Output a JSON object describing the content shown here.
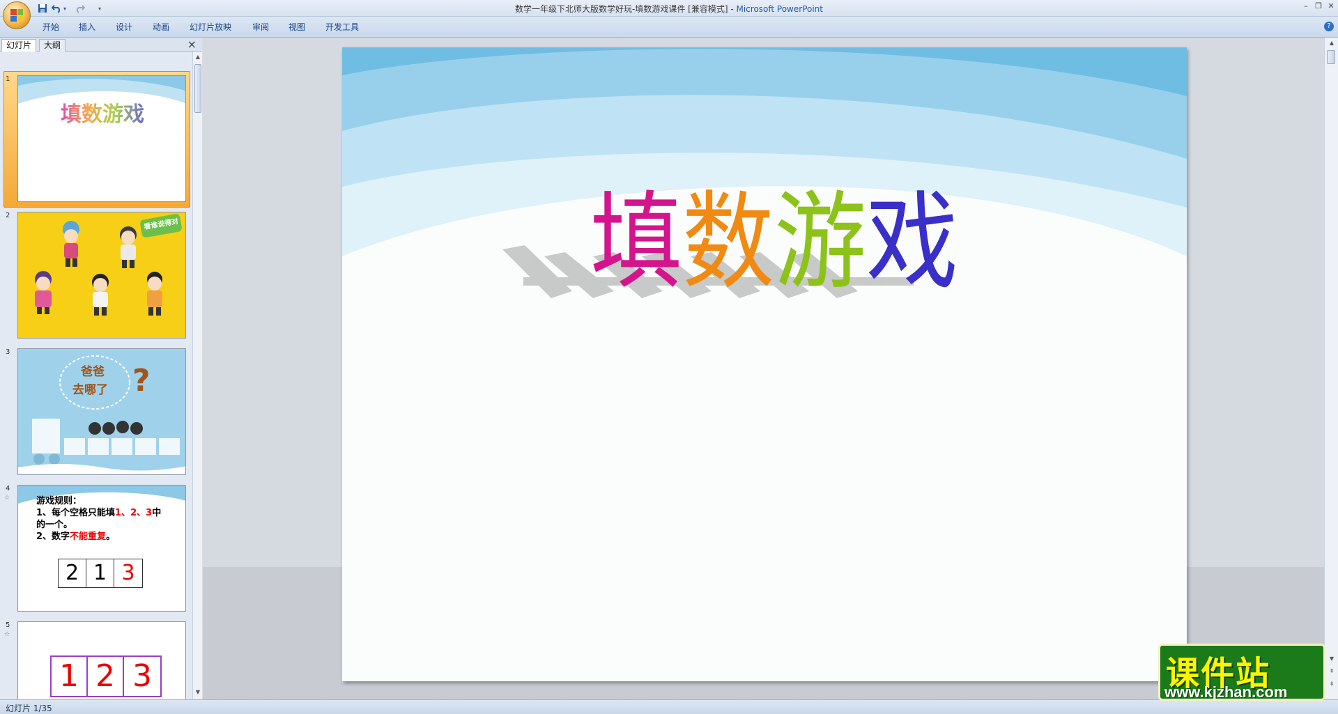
{
  "window": {
    "title_doc": "数学一年级下北师大版数学好玩-填数游戏课件 [兼容模式] - ",
    "title_app": "Microsoft PowerPoint"
  },
  "ribbon": {
    "tabs": [
      "开始",
      "插入",
      "设计",
      "动画",
      "幻灯片放映",
      "审阅",
      "视图",
      "开发工具"
    ]
  },
  "panel": {
    "tab_slides": "幻灯片",
    "tab_outline": "大纲",
    "close_glyph": "×"
  },
  "thumbnails": [
    {
      "num": "1",
      "title": "填数游戏"
    },
    {
      "num": "2",
      "badge": "看谁说得对"
    },
    {
      "num": "3",
      "bubble_line1": "爸爸",
      "bubble_line2": "去哪了",
      "question": "?"
    },
    {
      "num": "4",
      "rules_title": "游戏规则：",
      "rule1_a": "1、每个空格只能填",
      "rule1_b": "1、2、3",
      "rule1_c": "中",
      "rule1_d": "的一个。",
      "rule2_a": "2、数字",
      "rule2_b": "不能重复",
      "rule2_c": "。",
      "cells": [
        "2",
        "1",
        "3"
      ]
    },
    {
      "num": "5",
      "cells": [
        "1",
        "2",
        "3"
      ]
    }
  ],
  "slide": {
    "title_chars": [
      "填",
      "数",
      "游",
      "戏"
    ],
    "title_colors": [
      "#d4148c",
      "#f08a12",
      "#8cc21a",
      "#3a2fc8"
    ]
  },
  "status": {
    "slide_indicator": "幻灯片 1/35"
  },
  "watermark": {
    "main": "课件站",
    "url": "www.kjzhan.com"
  }
}
